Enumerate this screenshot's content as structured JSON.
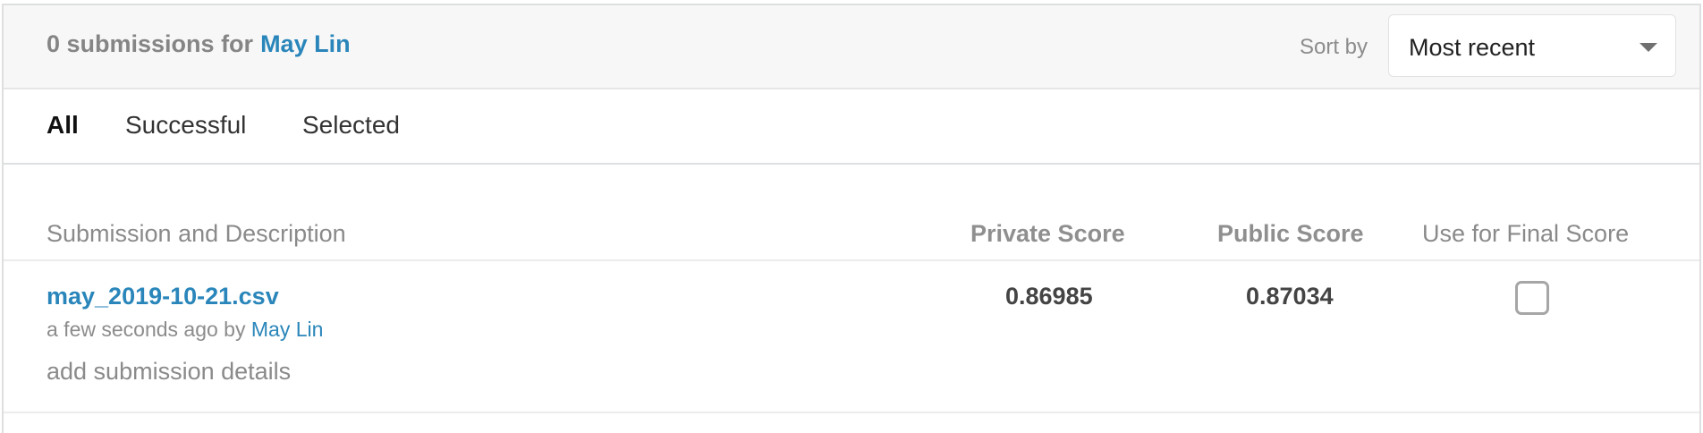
{
  "header": {
    "title_prefix": "0 submissions for",
    "user_name": "May Lin",
    "sort_label": "Sort by",
    "sort_value": "Most recent"
  },
  "tabs": [
    {
      "label": "All",
      "active": true
    },
    {
      "label": "Successful",
      "active": false
    },
    {
      "label": "Selected",
      "active": false
    }
  ],
  "table": {
    "columns": {
      "description": "Submission and Description",
      "private": "Private Score",
      "public": "Public Score",
      "final": "Use for Final Score"
    },
    "rows": [
      {
        "file_name": "may_2019-10-21.csv",
        "meta_prefix": "a few seconds ago by",
        "meta_user": "May Lin",
        "add_details": "add submission details",
        "private_score": "0.86985",
        "public_score": "0.87034",
        "use_for_final": false
      }
    ]
  },
  "colors": {
    "link": "#2a86ba",
    "header_bg": "#f7f7f7",
    "muted_text": "#8a8a8a"
  },
  "icons": {
    "sort_caret": "chevron-down-icon"
  }
}
